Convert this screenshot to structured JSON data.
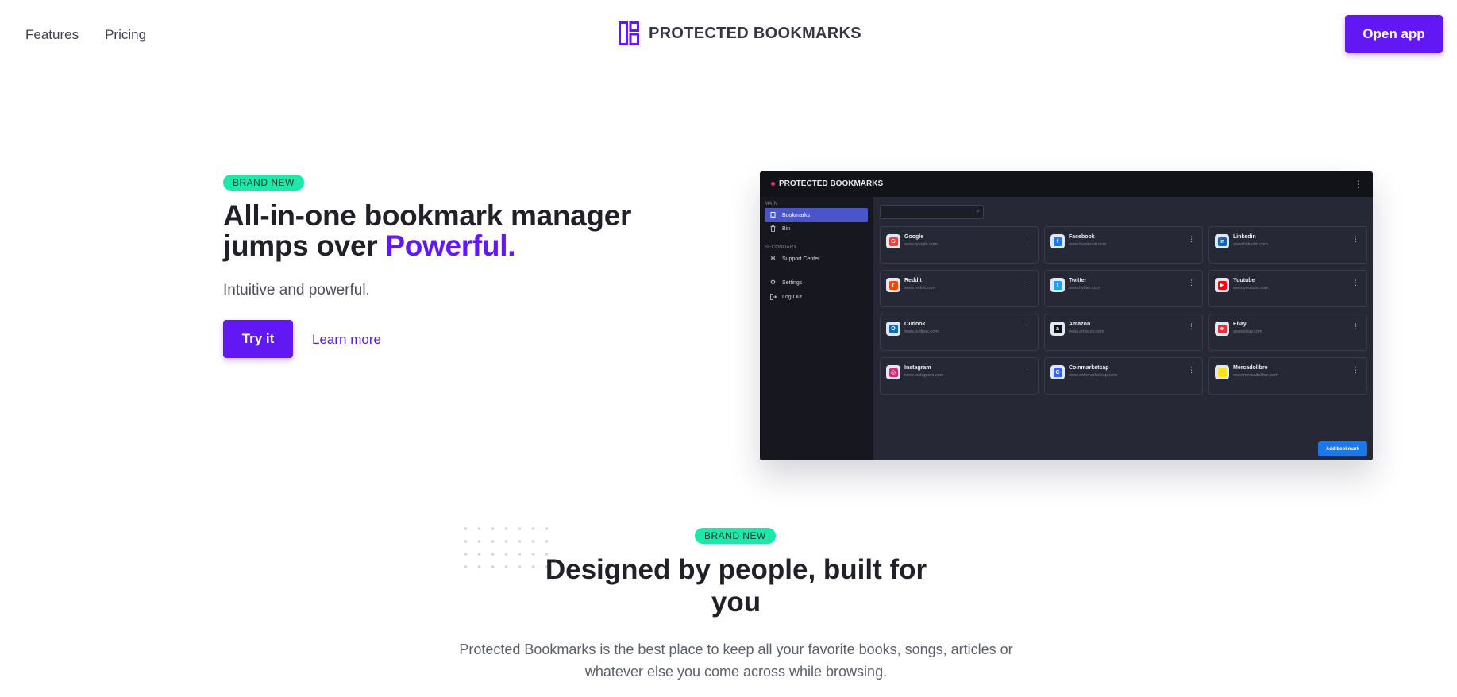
{
  "nav": {
    "links": [
      "Features",
      "Pricing"
    ],
    "brand": "PROTECTED BOOKMARKS",
    "open_app": "Open app"
  },
  "hero": {
    "badge": "BRAND NEW",
    "title_line1": "All-in-one bookmark manager",
    "title_line2_prefix": "jumps over ",
    "title_line2_accent": "Powerful.",
    "subtitle": "Intuitive and powerful.",
    "cta_primary": "Try it",
    "cta_secondary": "Learn more"
  },
  "preview": {
    "brand": "PROTECTED BOOKMARKS",
    "sidebar": {
      "main_label": "MAIN",
      "secondary_label": "SECONDARY",
      "items": [
        {
          "label": "Bookmarks",
          "icon": "bookmark-icon"
        },
        {
          "label": "Bin",
          "icon": "trash-icon"
        },
        {
          "label": "Support Center",
          "icon": "support-icon"
        },
        {
          "label": "Settings",
          "icon": "gear-icon"
        },
        {
          "label": "Log Out",
          "icon": "logout-icon"
        }
      ]
    },
    "bookmarks": [
      {
        "name": "Google",
        "url": "www.google.com",
        "color": "#ea4335",
        "glyph": "G"
      },
      {
        "name": "Facebook",
        "url": "www.facebook.com",
        "color": "#1877f2",
        "glyph": "f"
      },
      {
        "name": "Linkedin",
        "url": "www.linkedin.com",
        "color": "#0a66c2",
        "glyph": "in"
      },
      {
        "name": "Reddit",
        "url": "www.reddit.com",
        "color": "#ff4500",
        "glyph": "r"
      },
      {
        "name": "Twitter",
        "url": "www.twitter.com",
        "color": "#1da1f2",
        "glyph": "t"
      },
      {
        "name": "Youtube",
        "url": "www.youtube.com",
        "color": "#ff0000",
        "glyph": "▶"
      },
      {
        "name": "Outlook",
        "url": "www.outlook.com",
        "color": "#0f6cbd",
        "glyph": "O"
      },
      {
        "name": "Amazon",
        "url": "www.amazon.com",
        "color": "#111111",
        "glyph": "a"
      },
      {
        "name": "Ebay",
        "url": "www.ebay.com",
        "color": "#e53238",
        "glyph": "e"
      },
      {
        "name": "Instagram",
        "url": "www.instagram.com",
        "color": "#d62976",
        "glyph": "◎"
      },
      {
        "name": "Coinmarketcap",
        "url": "www.coinmarketcap.com",
        "color": "#3861fb",
        "glyph": "C"
      },
      {
        "name": "Mercadolibre",
        "url": "www.mercadolibre.com",
        "color": "#ffe600",
        "glyph": "~"
      }
    ],
    "add_button": "Add bookmark"
  },
  "section": {
    "badge": "BRAND NEW",
    "title": "Designed by people, built for you",
    "text": "Protected Bookmarks is the best place to keep all your favorite books, songs, articles or whatever else you come across while browsing."
  },
  "colors": {
    "accent": "#6118f2",
    "badge": "#1ee8a8",
    "app_bg": "#262835",
    "app_sidebar": "#17181f",
    "app_active": "#4a55c9",
    "app_add": "#1c78e8"
  }
}
